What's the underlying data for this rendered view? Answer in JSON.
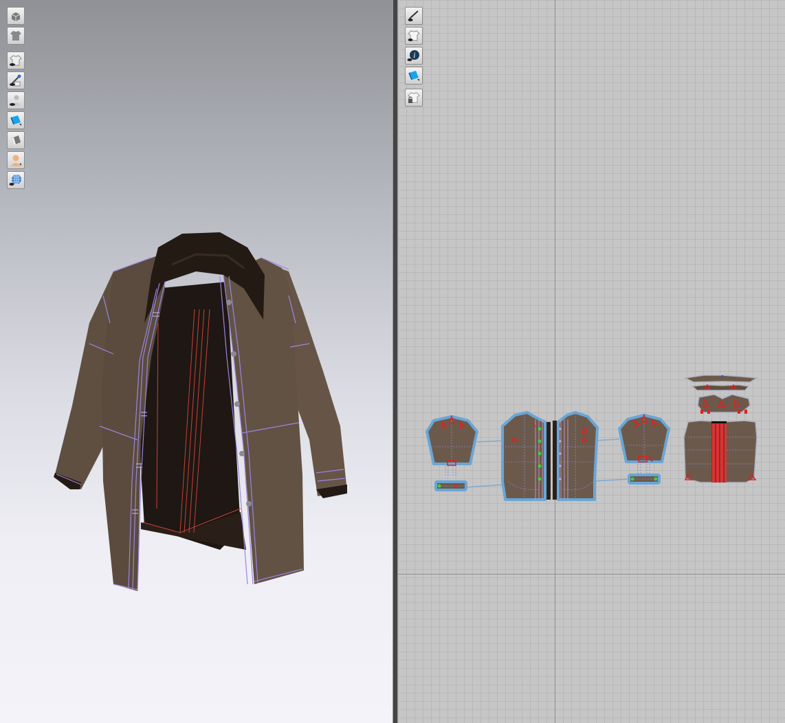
{
  "viewport_3d": {
    "toolbar": [
      {
        "icon": "cube-render-icon"
      },
      {
        "icon": "garment-texture-icon"
      },
      {
        "icon": "show-garment-icon"
      },
      {
        "icon": "show-pins-icon"
      },
      {
        "icon": "show-avatar-icon"
      },
      {
        "icon": "fabric-display-icon"
      },
      {
        "icon": "shaded-mode-icon"
      },
      {
        "icon": "avatar-skin-icon"
      },
      {
        "icon": "environment-globe-icon"
      }
    ]
  },
  "viewport_2d": {
    "toolbar": [
      {
        "icon": "show-sewing-lines-icon"
      },
      {
        "icon": "show-pattern-icon"
      },
      {
        "icon": "pattern-info-icon"
      },
      {
        "icon": "fabric-display-icon"
      },
      {
        "icon": "lock-pattern-icon"
      }
    ]
  },
  "colors": {
    "fabric": "#5e4f41",
    "fabric_dark": "#241a14",
    "fabric_lining": "#1e1713",
    "topstitch": "#9b86e0",
    "seam_red": "#c8433a",
    "pattern_outline": "#6aa6d6",
    "pattern_fill": "#6b5a4c",
    "notch_red": "#e02020",
    "button_green": "#3bd23b"
  }
}
